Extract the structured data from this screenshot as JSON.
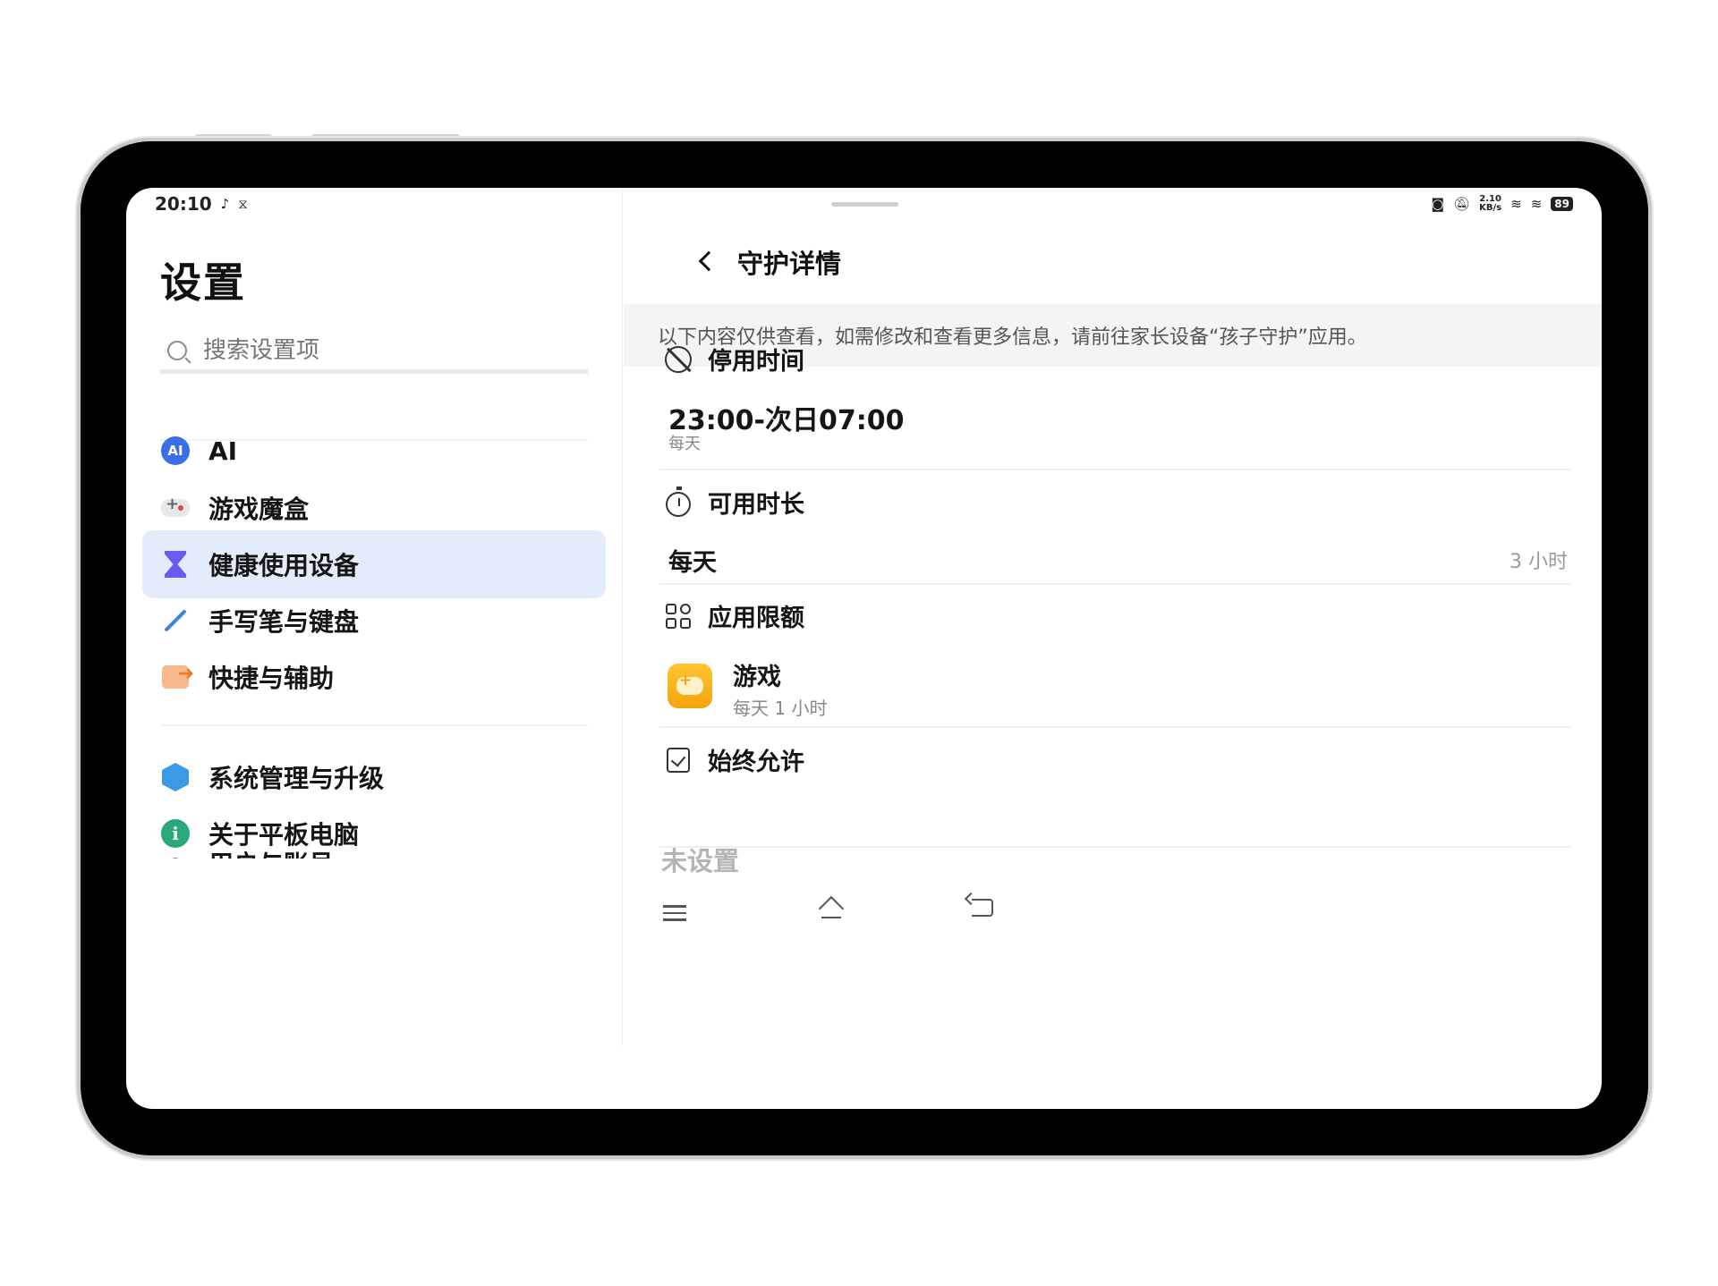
{
  "status_bar": {
    "time": "20:10",
    "net_speed_top": "2.10",
    "net_speed_bottom": "KB/s",
    "battery": "89",
    "left_icons": [
      "music-note-icon",
      "hourglass-icon"
    ],
    "right_icons": [
      "camera-icon",
      "mute-icon",
      "wifi-icon",
      "hotspot-icon",
      "battery-icon"
    ]
  },
  "sidebar": {
    "title": "设置",
    "search_placeholder": "搜索设置项",
    "items": [
      {
        "label": "AI",
        "icon": "ai-icon"
      },
      {
        "label": "游戏魔盒",
        "icon": "gamepad-icon"
      },
      {
        "label": "健康使用设备",
        "icon": "hourglass-icon",
        "active": true
      },
      {
        "label": "手写笔与键盘",
        "icon": "stylus-icon"
      },
      {
        "label": "快捷与辅助",
        "icon": "shortcut-icon"
      },
      {
        "label": "系统管理与升级",
        "icon": "cube-icon"
      },
      {
        "label": "关于平板电脑",
        "icon": "info-icon"
      },
      {
        "label": "用户与账号",
        "icon": "user-icon"
      }
    ]
  },
  "detail": {
    "title": "守护详情",
    "notice": "以下内容仅供查看，如需修改和查看更多信息，请前往家长设备“孩子守护”应用。",
    "downtime": {
      "heading": "停用时间",
      "range": "23:00-次日07:00",
      "repeat": "每天"
    },
    "screen_time": {
      "heading": "可用时长",
      "label": "每天",
      "value": "3 小时"
    },
    "app_limits": {
      "heading": "应用限额",
      "app_name": "游戏",
      "app_limit": "每天 1 小时"
    },
    "always_allowed": {
      "heading": "始终允许",
      "value": "未设置"
    }
  },
  "colors": {
    "accent": "#3a6ee8",
    "active_bg": "#e4ecfb",
    "game_icon": "#f5a30e"
  }
}
